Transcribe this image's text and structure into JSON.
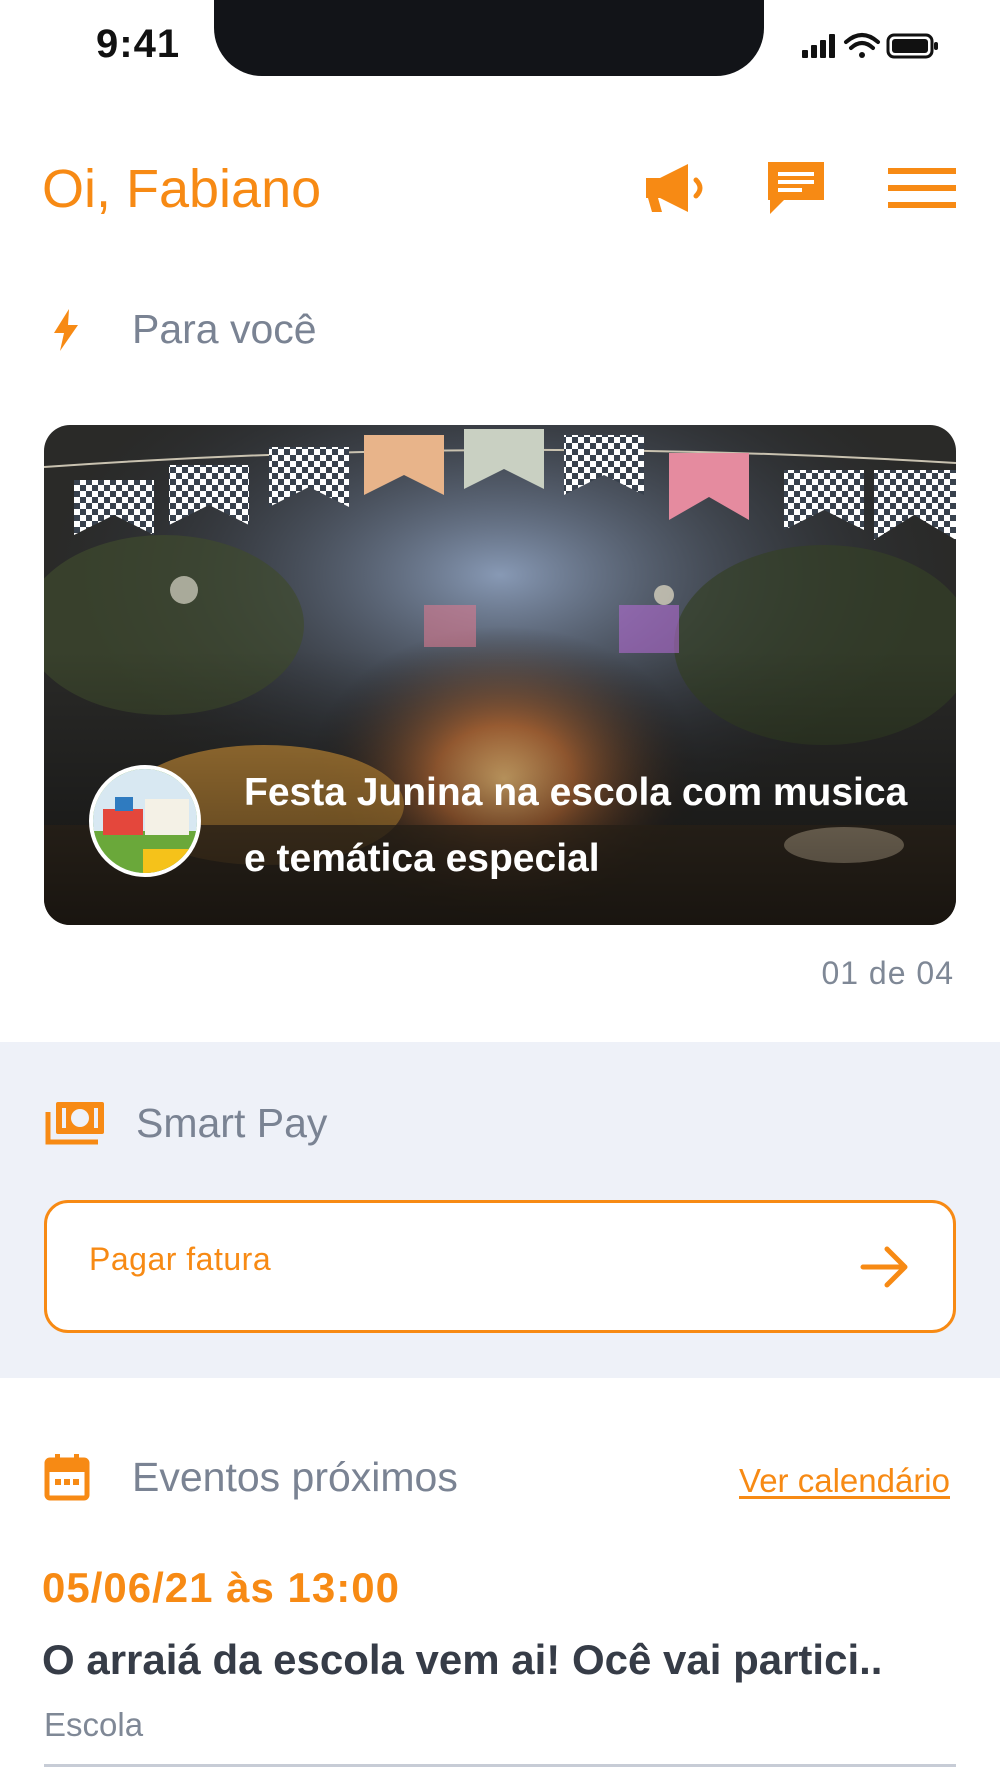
{
  "status_bar": {
    "time": "9:41"
  },
  "header": {
    "greeting": "Oi, Fabiano",
    "icons": [
      "megaphone-icon",
      "chat-icon",
      "menu-icon"
    ]
  },
  "para_voce": {
    "title": "Para você",
    "icon": "lightning-icon",
    "card": {
      "title": "Festa Junina na escola com musica e temática especial",
      "pager": "01 de 04"
    }
  },
  "smart_pay": {
    "title": "Smart Pay",
    "icon": "money-icon",
    "button_label": "Pagar fatura"
  },
  "events": {
    "title": "Eventos próximos",
    "icon": "calendar-icon",
    "link_label": "Ver calendário",
    "items": [
      {
        "date": "05/06/21 às 13:00",
        "title": "O arraiá da escola vem ai! Ocê vai partici..",
        "category": "Escola"
      }
    ]
  },
  "colors": {
    "accent": "#f78a14",
    "muted_text": "#7a8393",
    "dark_text": "#363c47",
    "section_bg": "#eef1f8"
  }
}
